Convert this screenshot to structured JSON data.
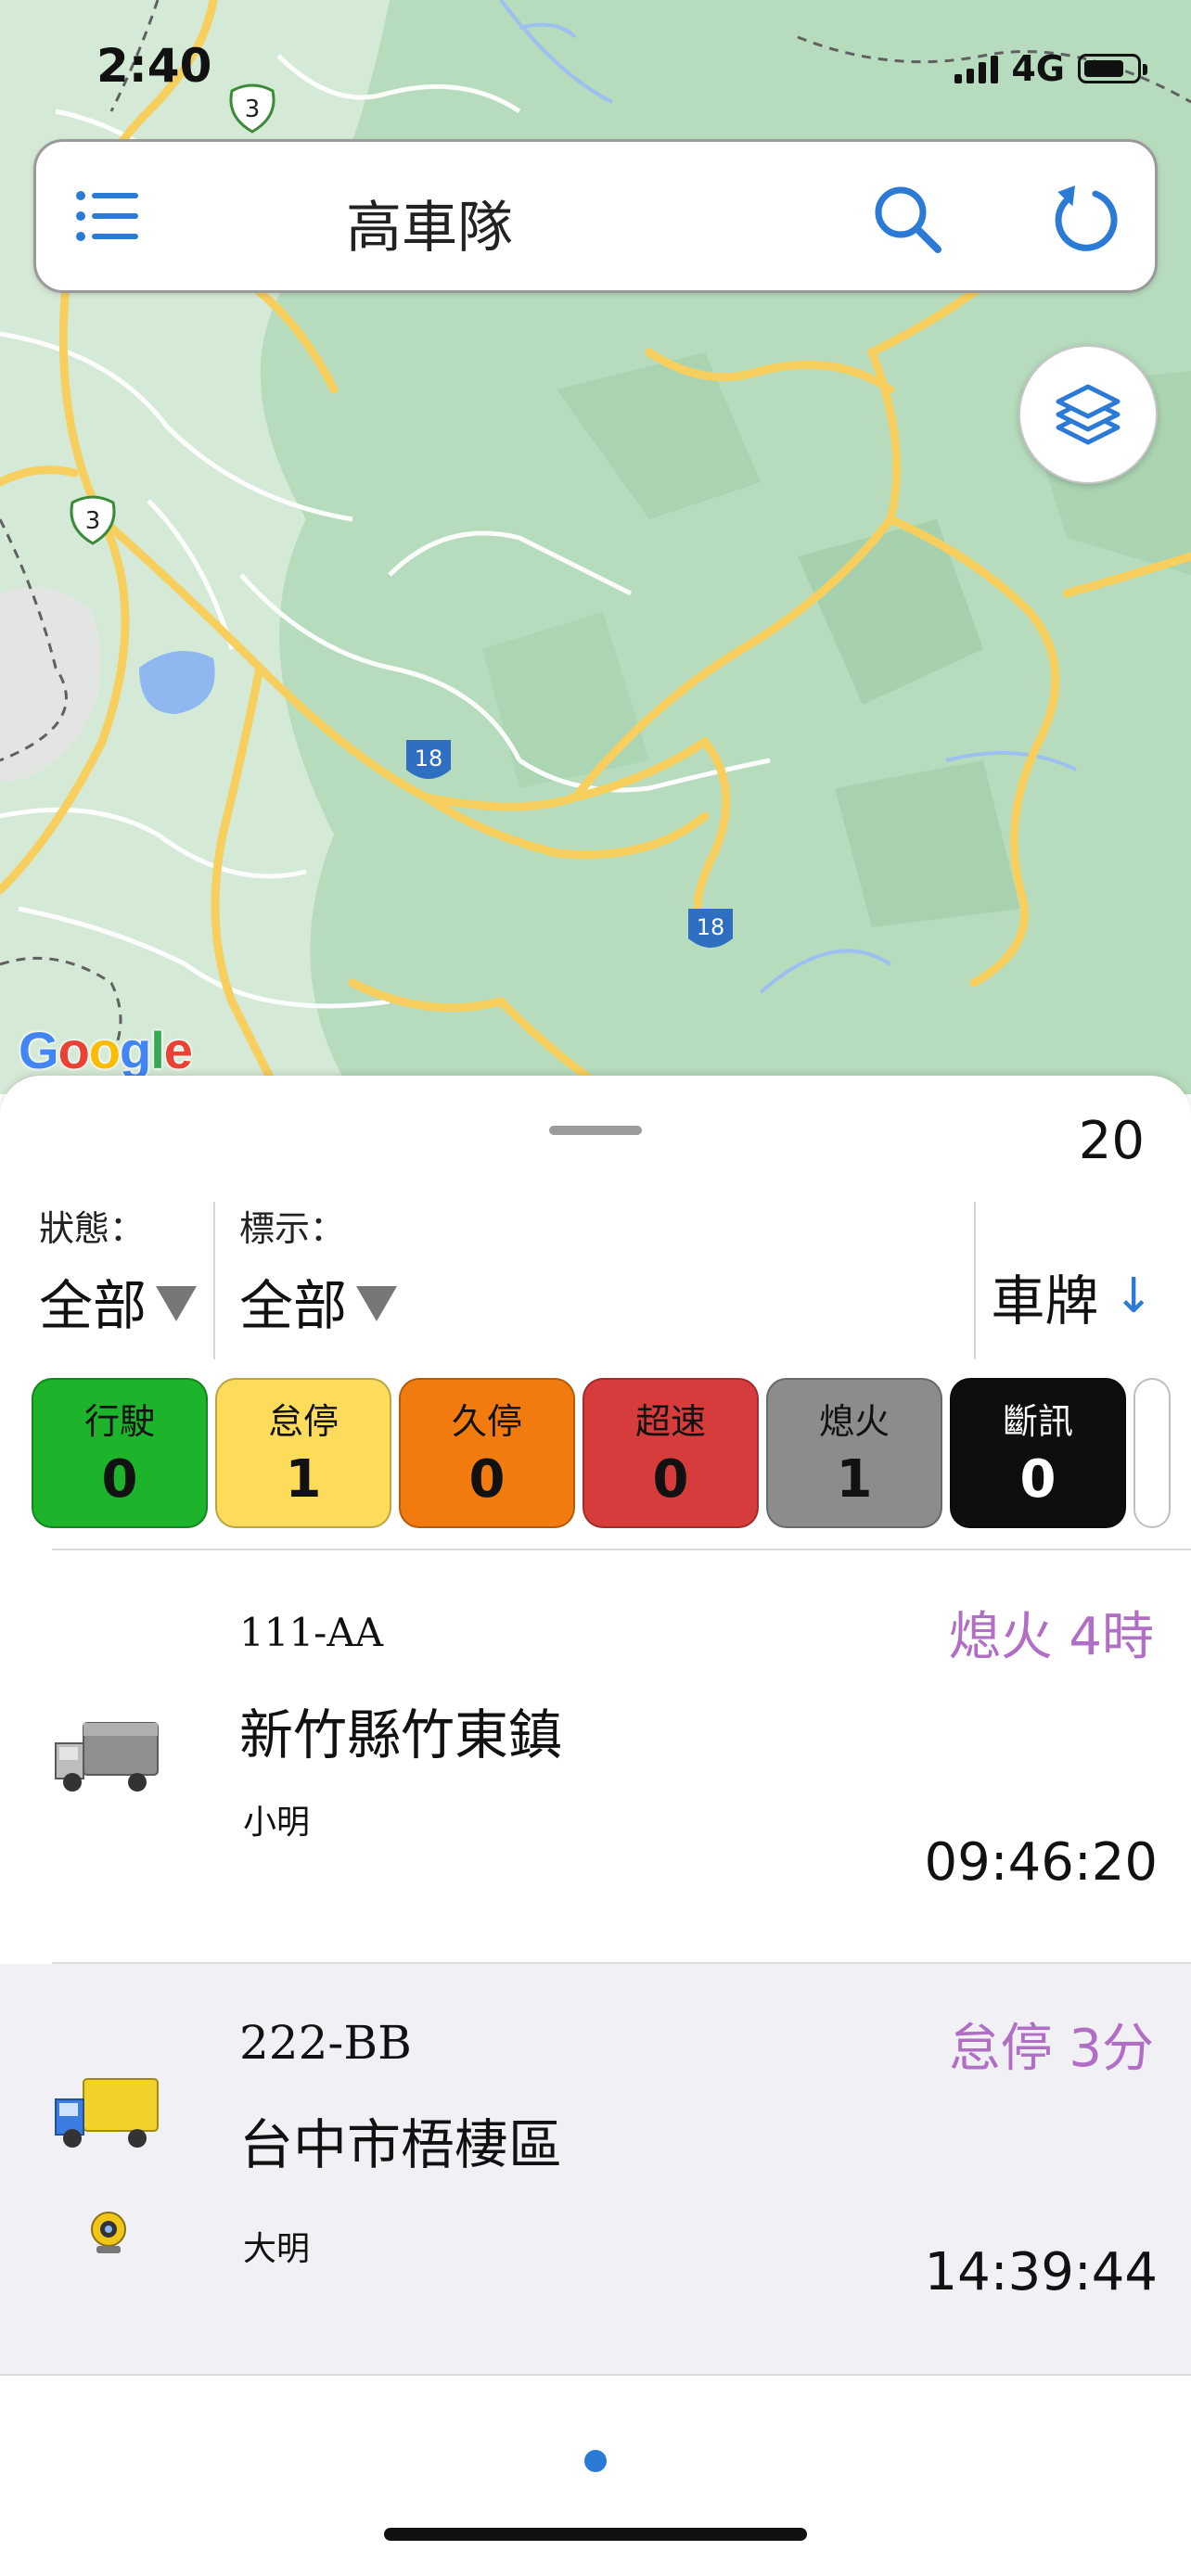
{
  "status_bar": {
    "time": "2:40",
    "network": "4G",
    "battery_percent": 80
  },
  "header": {
    "title": "高車隊",
    "menu_icon": "list-icon",
    "search_icon": "search-icon",
    "refresh_icon": "refresh-icon"
  },
  "map": {
    "layers_icon": "layers-icon",
    "route_shields": [
      "3",
      "3",
      "18",
      "18"
    ],
    "attribution": "Google"
  },
  "sheet": {
    "vehicle_count": "20",
    "status_filter": {
      "label": "狀態：",
      "value": "全部"
    },
    "tag_filter": {
      "label": "標示：",
      "value": "全部"
    },
    "sort": {
      "label": "車牌",
      "direction": "↓"
    }
  },
  "status_chips": [
    {
      "label": "行駛",
      "count": "0",
      "color": "#1db32a",
      "text_color": "#111111"
    },
    {
      "label": "怠停",
      "count": "1",
      "color": "#fcdc5a",
      "text_color": "#111111"
    },
    {
      "label": "久停",
      "count": "0",
      "color": "#f27b0f",
      "text_color": "#111111"
    },
    {
      "label": "超速",
      "count": "0",
      "color": "#d63c3c",
      "text_color": "#111111"
    },
    {
      "label": "熄火",
      "count": "1",
      "color": "#8c8c8c",
      "text_color": "#111111"
    },
    {
      "label": "斷訊",
      "count": "0",
      "color": "#0e0e0e",
      "text_color": "#ffffff"
    }
  ],
  "vehicles": [
    {
      "plate": "111-AA",
      "location": "新竹縣竹東鎮",
      "driver": "小明",
      "status": "熄火 4時",
      "time": "09:46:20",
      "truck_color": "gray",
      "has_camera": false
    },
    {
      "plate": "222-BB",
      "location": "台中市梧棲區",
      "driver": "大明",
      "status": "怠停 3分",
      "time": "14:39:44",
      "truck_color": "yellow-blue",
      "has_camera": true
    }
  ]
}
